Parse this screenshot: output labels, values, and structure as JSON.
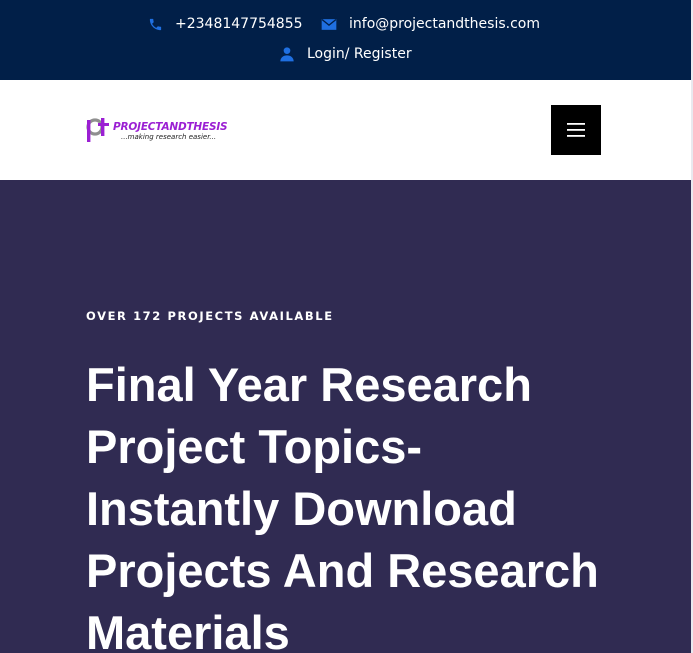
{
  "topbar": {
    "phone": "+2348147754855",
    "email": "info@projectandthesis.com",
    "login": "Login/ Register",
    "icons": {
      "phone": "phone-icon",
      "email": "envelope-icon",
      "user": "user-icon"
    },
    "colors": {
      "background": "#011f48",
      "icon": "#1f6fe0"
    }
  },
  "navbar": {
    "logo": {
      "mark": "pt",
      "brand": "PROJECTANDTHESIS",
      "tagline": "...making research easier..."
    },
    "menu_icon": "hamburger-menu-icon"
  },
  "hero": {
    "eyebrow": "OVER 172 PROJECTS AVAILABLE",
    "headline": "Final Year Research Project Topics- Instantly Download Projects And Research Materials",
    "colors": {
      "background": "#302b52",
      "text": "#ffffff"
    }
  }
}
